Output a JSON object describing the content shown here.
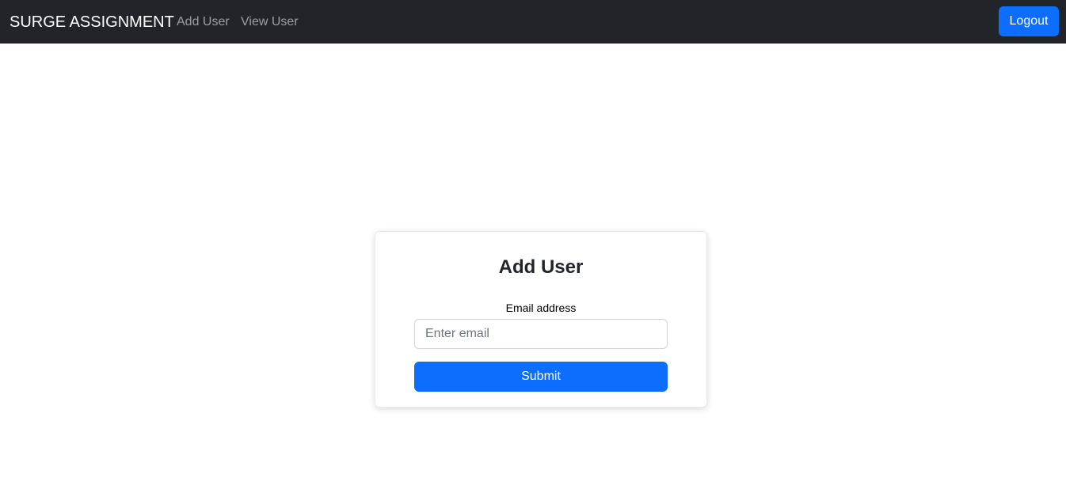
{
  "navbar": {
    "brand": "SURGE ASSIGNMENT",
    "links": [
      {
        "label": "Add User"
      },
      {
        "label": "View User"
      }
    ],
    "logout_label": "Logout"
  },
  "form": {
    "title": "Add User",
    "email_label": "Email address",
    "email_placeholder": "Enter email",
    "email_value": "",
    "submit_label": "Submit"
  },
  "colors": {
    "navbar_bg": "#212529",
    "primary": "#0d6efd",
    "nav_link": "#8c8f92"
  }
}
